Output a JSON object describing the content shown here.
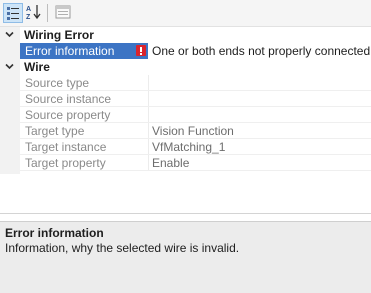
{
  "toolbar": {
    "buttons": [
      {
        "icon": "categorized-view-icon",
        "active": true
      },
      {
        "icon": "alphabetical-sort-icon",
        "active": false
      },
      {
        "icon": "property-pages-icon",
        "active": false
      }
    ]
  },
  "grid": {
    "categories": [
      {
        "label": "Wiring Error",
        "rows": [
          {
            "name": "Error information",
            "value": "One or both ends not properly connected.",
            "selected": true,
            "error": true
          }
        ]
      },
      {
        "label": "Wire",
        "rows": [
          {
            "name": "Source type",
            "value": ""
          },
          {
            "name": "Source instance",
            "value": ""
          },
          {
            "name": "Source property",
            "value": ""
          },
          {
            "name": "Target type",
            "value": "Vision Function"
          },
          {
            "name": "Target instance",
            "value": "VfMatching_1"
          },
          {
            "name": "Target property",
            "value": "Enable"
          }
        ]
      }
    ]
  },
  "help": {
    "title": "Error information",
    "description": "Information, why the selected wire is invalid."
  },
  "colors": {
    "selection": "#3c74c4",
    "error": "#d9232d",
    "help_background": "#ececec"
  }
}
